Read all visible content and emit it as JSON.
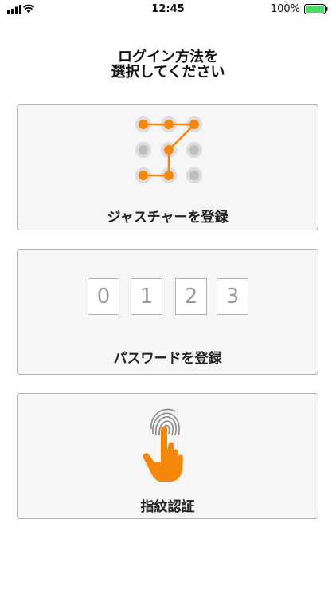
{
  "status_bar": {
    "time": "12:45",
    "battery_percent": "100%",
    "battery_level": 1.0,
    "battery_color": "#4cd964"
  },
  "title": {
    "line1": "ログイン方法を",
    "line2": "選択してください"
  },
  "options": [
    {
      "label": "ジャスチャーを登録",
      "icon": "gesture-pattern-icon"
    },
    {
      "label": "パスワードを登録",
      "icon": "passcode-digits-icon",
      "digits": [
        "0",
        "1",
        "2",
        "3"
      ]
    },
    {
      "label": "指紋認証",
      "icon": "fingerprint-hand-icon"
    }
  ],
  "colors": {
    "accent": "#f5870a",
    "inactive_dot": "#bdbdbd",
    "card_bg": "#f6f6f6"
  }
}
